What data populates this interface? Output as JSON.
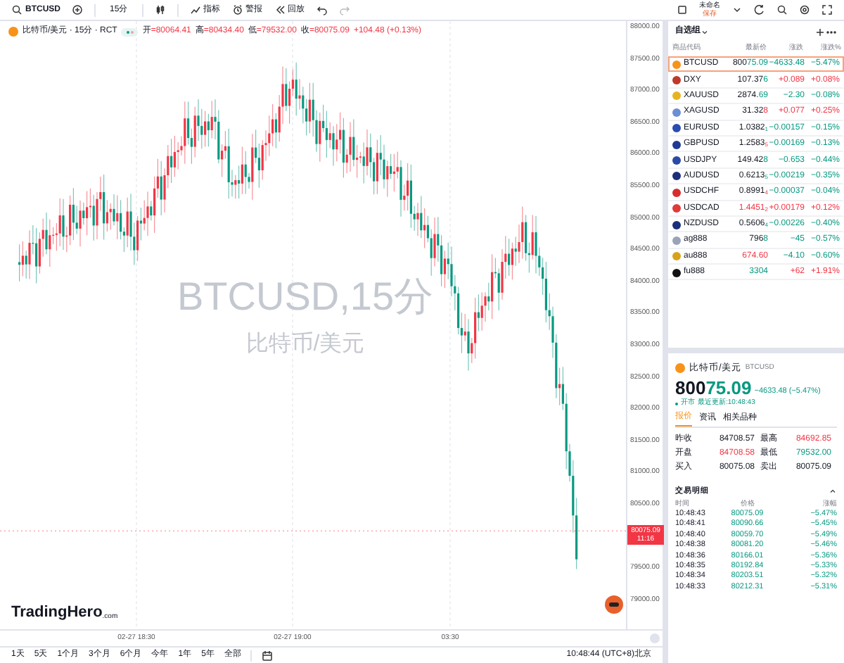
{
  "toolbar": {
    "symbol": "BTCUSD",
    "interval": "15分",
    "items": [
      {
        "kind": "indicator",
        "label": "指标"
      },
      {
        "kind": "alert",
        "label": "警报"
      },
      {
        "kind": "replay",
        "label": "回放"
      }
    ],
    "layout_name": "未命名",
    "save": "保存"
  },
  "legend": {
    "name": "比特币/美元 · 15分 · RCT",
    "fields": [
      {
        "label": "开",
        "value": "=80064.41"
      },
      {
        "label": "高",
        "value": "=80434.40"
      },
      {
        "label": "低",
        "value": "=79532.00"
      },
      {
        "label": "收",
        "value": "=80075.09"
      }
    ],
    "change": "+104.48 (+0.13%)"
  },
  "chart": {
    "watermark_symbol": "BTCUSD,15分",
    "watermark_name": "比特币/美元",
    "price_ticks_upper": [
      "88000.00",
      "87500.00",
      "87000.00",
      "86500.00",
      "86000.00",
      "85500.00",
      "85000.00",
      "84500.00",
      "84000.00",
      "83500.00",
      "83000.00",
      "82500.00",
      "82000.00",
      "81500.00",
      "81000.00",
      "80500.00"
    ],
    "price_ticks_lower": [
      "79500.00",
      "79000.00"
    ],
    "current_price": "80075.09",
    "countdown": "11:16",
    "time_labels": [
      "02-27 18:30",
      "02-27 19:00",
      "03:30"
    ],
    "logo": "TradingHero",
    "logo_suffix": ".com"
  },
  "ranges": [
    "1天",
    "5天",
    "1个月",
    "3个月",
    "6个月",
    "今年",
    "1年",
    "5年",
    "全部"
  ],
  "clock": "10:48:44 (UTC+8)北京",
  "watchlist": {
    "title": "自选组",
    "columns": [
      "商品代码",
      "最新价",
      "涨跌",
      "涨跌%"
    ],
    "rows": [
      {
        "symbol": "BTCUSD",
        "color": "#f7931a",
        "last_plain": "800",
        "last_colored": "75.09",
        "tick_up": false,
        "change": "−4633.48",
        "pct": "−5.47%",
        "up": false,
        "selected": true
      },
      {
        "symbol": "DXY",
        "color": "#c0392b",
        "last_plain": "107.37",
        "last_colored": "6",
        "tick_up": false,
        "change": "+0.089",
        "pct": "+0.08%",
        "up": true,
        "selected": false
      },
      {
        "symbol": "XAUUSD",
        "color": "#e6b422",
        "last_plain": "2874.",
        "last_colored": "69",
        "tick_up": false,
        "change": "−2.30",
        "pct": "−0.08%",
        "up": false,
        "selected": false
      },
      {
        "symbol": "XAGUSD",
        "color": "#6b8fd6",
        "last_plain": "31.32",
        "last_colored": "8",
        "tick_up": true,
        "change": "+0.077",
        "pct": "+0.25%",
        "up": true,
        "selected": false
      },
      {
        "symbol": "EURUSD",
        "color": "#2a4db3",
        "last_plain": "1.0382",
        "sub": "1",
        "tick_up": false,
        "change": "−0.00157",
        "pct": "−0.15%",
        "up": false,
        "selected": false
      },
      {
        "symbol": "GBPUSD",
        "color": "#1f3a93",
        "last_plain": "1.2583",
        "sub": "5",
        "tick_up": true,
        "change": "−0.00169",
        "pct": "−0.13%",
        "up": false,
        "selected": false
      },
      {
        "symbol": "USDJPY",
        "color": "#2b4aa8",
        "last_plain": "149.42",
        "last_colored": "8",
        "tick_up": false,
        "change": "−0.653",
        "pct": "−0.44%",
        "up": false,
        "selected": false
      },
      {
        "symbol": "AUDUSD",
        "color": "#1b2f7a",
        "last_plain": "0.6213",
        "sub": "5",
        "tick_up": false,
        "change": "−0.00219",
        "pct": "−0.35%",
        "up": false,
        "selected": false
      },
      {
        "symbol": "USDCHF",
        "color": "#d62e2e",
        "last_plain": "0.8991",
        "sub": "4",
        "tick_up": true,
        "change": "−0.00037",
        "pct": "−0.04%",
        "up": false,
        "selected": false
      },
      {
        "symbol": "USDCAD",
        "color": "#e03a3a",
        "last_colored": "1.4451",
        "sub": "2",
        "tick_up": true,
        "change": "+0.00179",
        "pct": "+0.12%",
        "up": true,
        "selected": false
      },
      {
        "symbol": "NZDUSD",
        "color": "#1b2f7a",
        "last_plain": "0.5606",
        "sub": "4",
        "tick_up": false,
        "change": "−0.00226",
        "pct": "−0.40%",
        "up": false,
        "selected": false
      },
      {
        "symbol": "ag888",
        "color": "#9aa4b8",
        "last_plain": "796",
        "last_colored": "8",
        "tick_up": false,
        "change": "−45",
        "pct": "−0.57%",
        "up": false,
        "selected": false
      },
      {
        "symbol": "au888",
        "color": "#d9a21b",
        "last_colored": "674.60",
        "tick_up": true,
        "change": "−4.10",
        "pct": "−0.60%",
        "up": false,
        "selected": false
      },
      {
        "symbol": "fu888",
        "color": "#111111",
        "last_colored": "3304",
        "tick_up": false,
        "change": "+62",
        "pct": "+1.91%",
        "up": true,
        "selected": false
      }
    ]
  },
  "detail": {
    "name": "比特币/美元",
    "symbol": "BTCUSD",
    "price_plain": "800",
    "price_colored": "75.09",
    "change": "−4633.48 (−5.47%)",
    "status": "开市",
    "updated": "最近更新:10:48:43",
    "tabs": [
      {
        "label": "报价",
        "selected": true
      },
      {
        "label": "资讯",
        "selected": false
      },
      {
        "label": "相关品种",
        "selected": false
      }
    ],
    "quote": [
      {
        "label": "昨收",
        "value": "84708.57",
        "color": "#131722"
      },
      {
        "label": "最高",
        "value": "84692.85",
        "color": "#f23645"
      },
      {
        "label": "开盘",
        "value": "84708.58",
        "color": "#f23645"
      },
      {
        "label": "最低",
        "value": "79532.00",
        "color": "#089981"
      },
      {
        "label": "买入",
        "value": "80075.08",
        "color": "#131722"
      },
      {
        "label": "卖出",
        "value": "80075.09",
        "color": "#131722"
      }
    ],
    "trades_title": "交易明细",
    "trade_columns": [
      "时间",
      "价格",
      "涨幅"
    ],
    "trades": [
      [
        "10:48:43",
        "80075.09",
        "−5.47%"
      ],
      [
        "10:48:41",
        "80090.66",
        "−5.45%"
      ],
      [
        "10:48:40",
        "80059.70",
        "−5.49%"
      ],
      [
        "10:48:38",
        "80081.20",
        "−5.46%"
      ],
      [
        "10:48:36",
        "80166.01",
        "−5.36%"
      ],
      [
        "10:48:35",
        "80192.84",
        "−5.33%"
      ],
      [
        "10:48:34",
        "80203.51",
        "−5.32%"
      ],
      [
        "10:48:33",
        "80212.31",
        "−5.31%"
      ]
    ]
  }
}
